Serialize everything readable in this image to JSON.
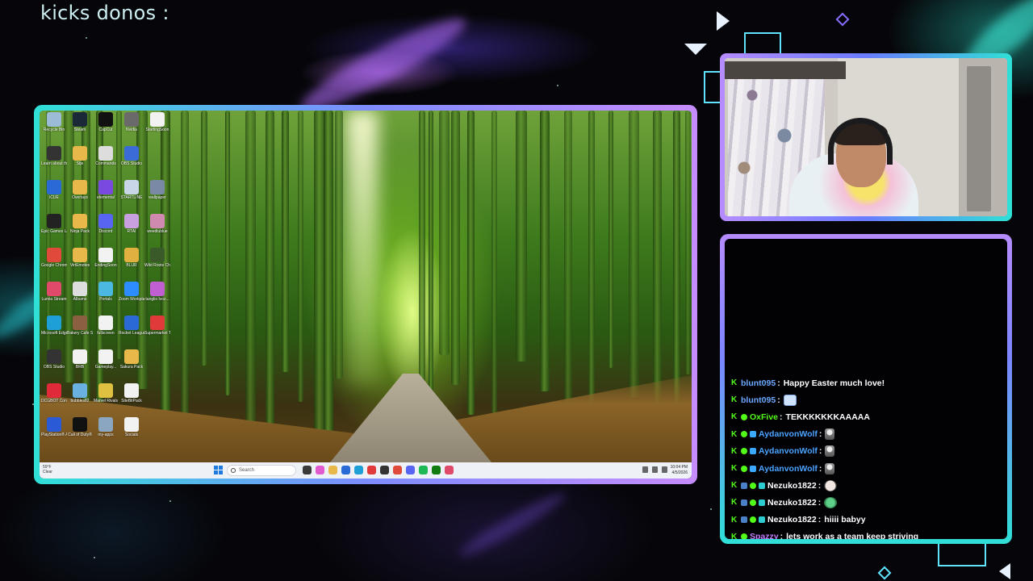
{
  "overlay": {
    "title": "kicks donos :"
  },
  "desktop": {
    "icons": [
      {
        "label": "Recycle Bin",
        "icon": "recycle-bin-icon",
        "color": "#9bbbd6"
      },
      {
        "label": "Steam",
        "icon": "steam-icon",
        "color": "#1b2838"
      },
      {
        "label": "CapCut",
        "icon": "capcut-icon",
        "color": "#111111"
      },
      {
        "label": "Nvidia",
        "icon": "nvidia-icon",
        "color": "#6a6a6a"
      },
      {
        "label": "StartingSoon",
        "icon": "file-icon",
        "color": "#f2f2f2"
      },
      {
        "label": "Learn about this picture",
        "icon": "camera-icon",
        "color": "#333333"
      },
      {
        "label": "Stje",
        "icon": "folder-icon",
        "color": "#e8b84a"
      },
      {
        "label": "Commands",
        "icon": "file-icon",
        "color": "#dddddd"
      },
      {
        "label": "OBS Studio",
        "icon": "obs-icon",
        "color": "#3b6bd6"
      },
      {
        "label": "",
        "icon": "blank-icon",
        "color": "transparent"
      },
      {
        "label": "iCUE",
        "icon": "icue-icon",
        "color": "#2a6ad6"
      },
      {
        "label": "Overlays",
        "icon": "folder-icon",
        "color": "#e8b84a"
      },
      {
        "label": "elemental",
        "icon": "app-icon",
        "color": "#7a4ae0"
      },
      {
        "label": "STARTLINE",
        "icon": "app-icon",
        "color": "#c8d6e8"
      },
      {
        "label": "wallpaper",
        "icon": "app-icon",
        "color": "#7a8aa6"
      },
      {
        "label": "Epic Games Launcher",
        "icon": "epic-games-icon",
        "color": "#222222"
      },
      {
        "label": "Ninja Pack",
        "icon": "folder-icon",
        "color": "#e8b84a"
      },
      {
        "label": "Discord",
        "icon": "discord-icon",
        "color": "#5865f2"
      },
      {
        "label": "RTAI",
        "icon": "app-icon",
        "color": "#c8a0e0"
      },
      {
        "label": "weedlublue",
        "icon": "app-icon",
        "color": "#d08ab0"
      },
      {
        "label": "Google Chrome",
        "icon": "chrome-icon",
        "color": "#e04a3a"
      },
      {
        "label": "VirtEmotes",
        "icon": "folder-icon",
        "color": "#e8b84a"
      },
      {
        "label": "EndingSoon",
        "icon": "file-icon",
        "color": "#f2f2f2"
      },
      {
        "label": "BLUR",
        "icon": "app-icon",
        "color": "#e0b040"
      },
      {
        "label": "Wild Roots Chef's Co...",
        "icon": "app-icon",
        "color": "#3a5a2a"
      },
      {
        "label": "Lumia Stream",
        "icon": "lumia-icon",
        "color": "#e04a6a"
      },
      {
        "label": "Albums",
        "icon": "file-icon",
        "color": "#dddddd"
      },
      {
        "label": "Portals",
        "icon": "app-icon",
        "color": "#4ab8e0"
      },
      {
        "label": "Zoom Workplace",
        "icon": "zoom-icon",
        "color": "#2d8cff"
      },
      {
        "label": "tanglio lvoz...",
        "icon": "app-icon",
        "color": "#c060d0"
      },
      {
        "label": "Microsoft Edge",
        "icon": "edge-icon",
        "color": "#1e9fd6"
      },
      {
        "label": "Bakery Cafe Simulator...",
        "icon": "app-icon",
        "color": "#8a6040"
      },
      {
        "label": "fullscreen",
        "icon": "file-icon",
        "color": "#f2f2f2"
      },
      {
        "label": "Rocket League®",
        "icon": "rocket-league-icon",
        "color": "#2a6ad6"
      },
      {
        "label": "Supermarket Together",
        "icon": "app-icon",
        "color": "#e03a3a"
      },
      {
        "label": "OBS Studio",
        "icon": "obs-icon",
        "color": "#333333"
      },
      {
        "label": "BRB",
        "icon": "file-icon",
        "color": "#f2f2f2"
      },
      {
        "label": "Gameplay...",
        "icon": "file-icon",
        "color": "#f2f2f2"
      },
      {
        "label": "Sakura Pack",
        "icon": "folder-icon",
        "color": "#e8b84a"
      },
      {
        "label": "",
        "icon": "blank-icon",
        "color": "transparent"
      },
      {
        "label": "DCGBOT Control",
        "icon": "app-icon",
        "color": "#e02a3a"
      },
      {
        "label": "bubbles82",
        "icon": "app-icon",
        "color": "#6ab0e0"
      },
      {
        "label": "Marvel Rivals",
        "icon": "marvel-rivals-icon",
        "color": "#e0c040"
      },
      {
        "label": "SiteBitPack",
        "icon": "file-icon",
        "color": "#f2f2f2"
      },
      {
        "label": "",
        "icon": "blank-icon",
        "color": "transparent"
      },
      {
        "label": "PlayStation® Accessories",
        "icon": "playstation-icon",
        "color": "#2a5ad6"
      },
      {
        "label": "Call of Duty®",
        "icon": "call-of-duty-icon",
        "color": "#111111"
      },
      {
        "label": "my-apps",
        "icon": "app-icon",
        "color": "#8aa6c0"
      },
      {
        "label": "Socials",
        "icon": "file-icon",
        "color": "#f2f2f2"
      }
    ],
    "taskbar": {
      "weather_temp": "59°F",
      "weather_desc": "Clear",
      "search_placeholder": "Search",
      "apps": [
        {
          "icon": "file-explorer-icon",
          "color": "#3a3a3a"
        },
        {
          "icon": "copilot-icon",
          "color": "#e05ad0"
        },
        {
          "icon": "folder-icon",
          "color": "#e8b84a"
        },
        {
          "icon": "store-icon",
          "color": "#2a6ad6"
        },
        {
          "icon": "edge-icon",
          "color": "#1e9fd6"
        },
        {
          "icon": "roblox-icon",
          "color": "#e03a3a"
        },
        {
          "icon": "obs-icon",
          "color": "#333333"
        },
        {
          "icon": "chrome-icon",
          "color": "#e04a3a"
        },
        {
          "icon": "discord-icon",
          "color": "#5865f2"
        },
        {
          "icon": "spotify-icon",
          "color": "#1db954"
        },
        {
          "icon": "xbox-icon",
          "color": "#107c10"
        },
        {
          "icon": "lumia-icon",
          "color": "#e04a6a"
        }
      ],
      "time": "10:04 PM",
      "date": "4/5/2026"
    }
  },
  "chat": {
    "messages": [
      {
        "user": "blunt095",
        "color": "#6aa9ff",
        "badges": [],
        "text": "Happy Easter much love!",
        "emote": ""
      },
      {
        "user": "blunt095",
        "color": "#6aa9ff",
        "badges": [],
        "text": "",
        "emote": "love"
      },
      {
        "user": "OxFive",
        "color": "#53fc18",
        "badges": [
          "g"
        ],
        "text": "TEKKKKKKKAAAAA",
        "emote": ""
      },
      {
        "user": "AydanvonWolf",
        "color": "#4aa3ff",
        "badges": [
          "g",
          "b"
        ],
        "text": "",
        "emote": "fig"
      },
      {
        "user": "AydanvonWolf",
        "color": "#4aa3ff",
        "badges": [
          "g",
          "b"
        ],
        "text": "",
        "emote": "fig"
      },
      {
        "user": "AydanvonWolf",
        "color": "#4aa3ff",
        "badges": [
          "g",
          "b"
        ],
        "text": "",
        "emote": "fig"
      },
      {
        "user": "Nezuko1822",
        "color": "#ffffff",
        "badges": [
          "x",
          "g",
          "s"
        ],
        "text": "",
        "emote": "face"
      },
      {
        "user": "Nezuko1822",
        "color": "#ffffff",
        "badges": [
          "x",
          "g",
          "s"
        ],
        "text": "",
        "emote": "heart"
      },
      {
        "user": "Nezuko1822",
        "color": "#ffffff",
        "badges": [
          "x",
          "g",
          "s"
        ],
        "text": "hiiii babyy",
        "emote": ""
      },
      {
        "user": "Spazzy",
        "color": "#c77dff",
        "badges": [
          "g"
        ],
        "text": "lets work as a team keep striving",
        "emote": ""
      }
    ]
  }
}
